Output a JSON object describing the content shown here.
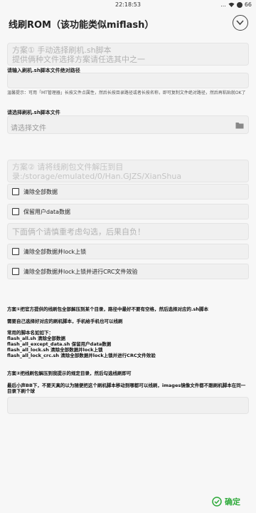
{
  "status_bar": {
    "time": "22:18:53",
    "signal": "...",
    "battery": "66"
  },
  "header": {
    "title": "线刷ROM（该功能类似miflash）"
  },
  "option1_hint": {
    "line1": "方案①  手动选择刷机.sh脚本",
    "line2": "提供俩种文件选择方案请任选其中之一"
  },
  "script_path": {
    "label": "请输入刷机.sh脚本文件绝对路径",
    "tip": "温馨提示：可用「MT管理器」长按文件点属性，然后长按目录路径或者长按名称，即可复制文件绝对路径，然后再粘贴就OK了"
  },
  "script_file": {
    "label": "请选择刷机.sh脚本文件",
    "placeholder": "请选择文件"
  },
  "option2_hint": {
    "text": "方案②  请将线刷包文件解压到目录:/storage/emulated/0/Han.GJZS/XianShua"
  },
  "options_top": [
    {
      "label": "清除全部数据"
    },
    {
      "label": "保留用户data数据"
    }
  ],
  "warning_hint": "下面俩个请慎重考虑勾选，后果自负！",
  "options_bottom": [
    {
      "label": "清除全部数据并lock上锁"
    },
    {
      "label": "清除全部数据并lock上锁并进行CRC文件效验"
    }
  ],
  "notes": {
    "p1": "方案①把官方提供的线刷包全部解压到某个目录，路径中最好不要有空格，然后选择对应的.sh脚本",
    "p2": "需要自己选择好对应的刷机脚本，手机给手机也可以线刷",
    "p3_title": "常用的脚本名如如下：",
    "p3_lines": [
      "flash_all.sh 清除全部数据",
      "flash_all_except_data.sh 保留用户data数据",
      "flash_all_lock.sh 清除全部数据并lock上锁",
      "flash_all_lock_crc.sh 清除全部数据并lock上锁并进行CRC文件效验"
    ],
    "p4": "方案②把线刷包解压到我提示的规定目录，然后勾选线刷即可",
    "p5": "最后小声BB下，不要天真的以为随便把这个刷机脚本移动到哪都可以线刷，images镜像文件都不跟刷机脚本在同一目录下刷个球"
  },
  "confirm": {
    "label": "确定"
  },
  "colors": {
    "accent": "#2eaa3a",
    "hint": "#b3b3b3",
    "box": "#f0f0f0"
  }
}
